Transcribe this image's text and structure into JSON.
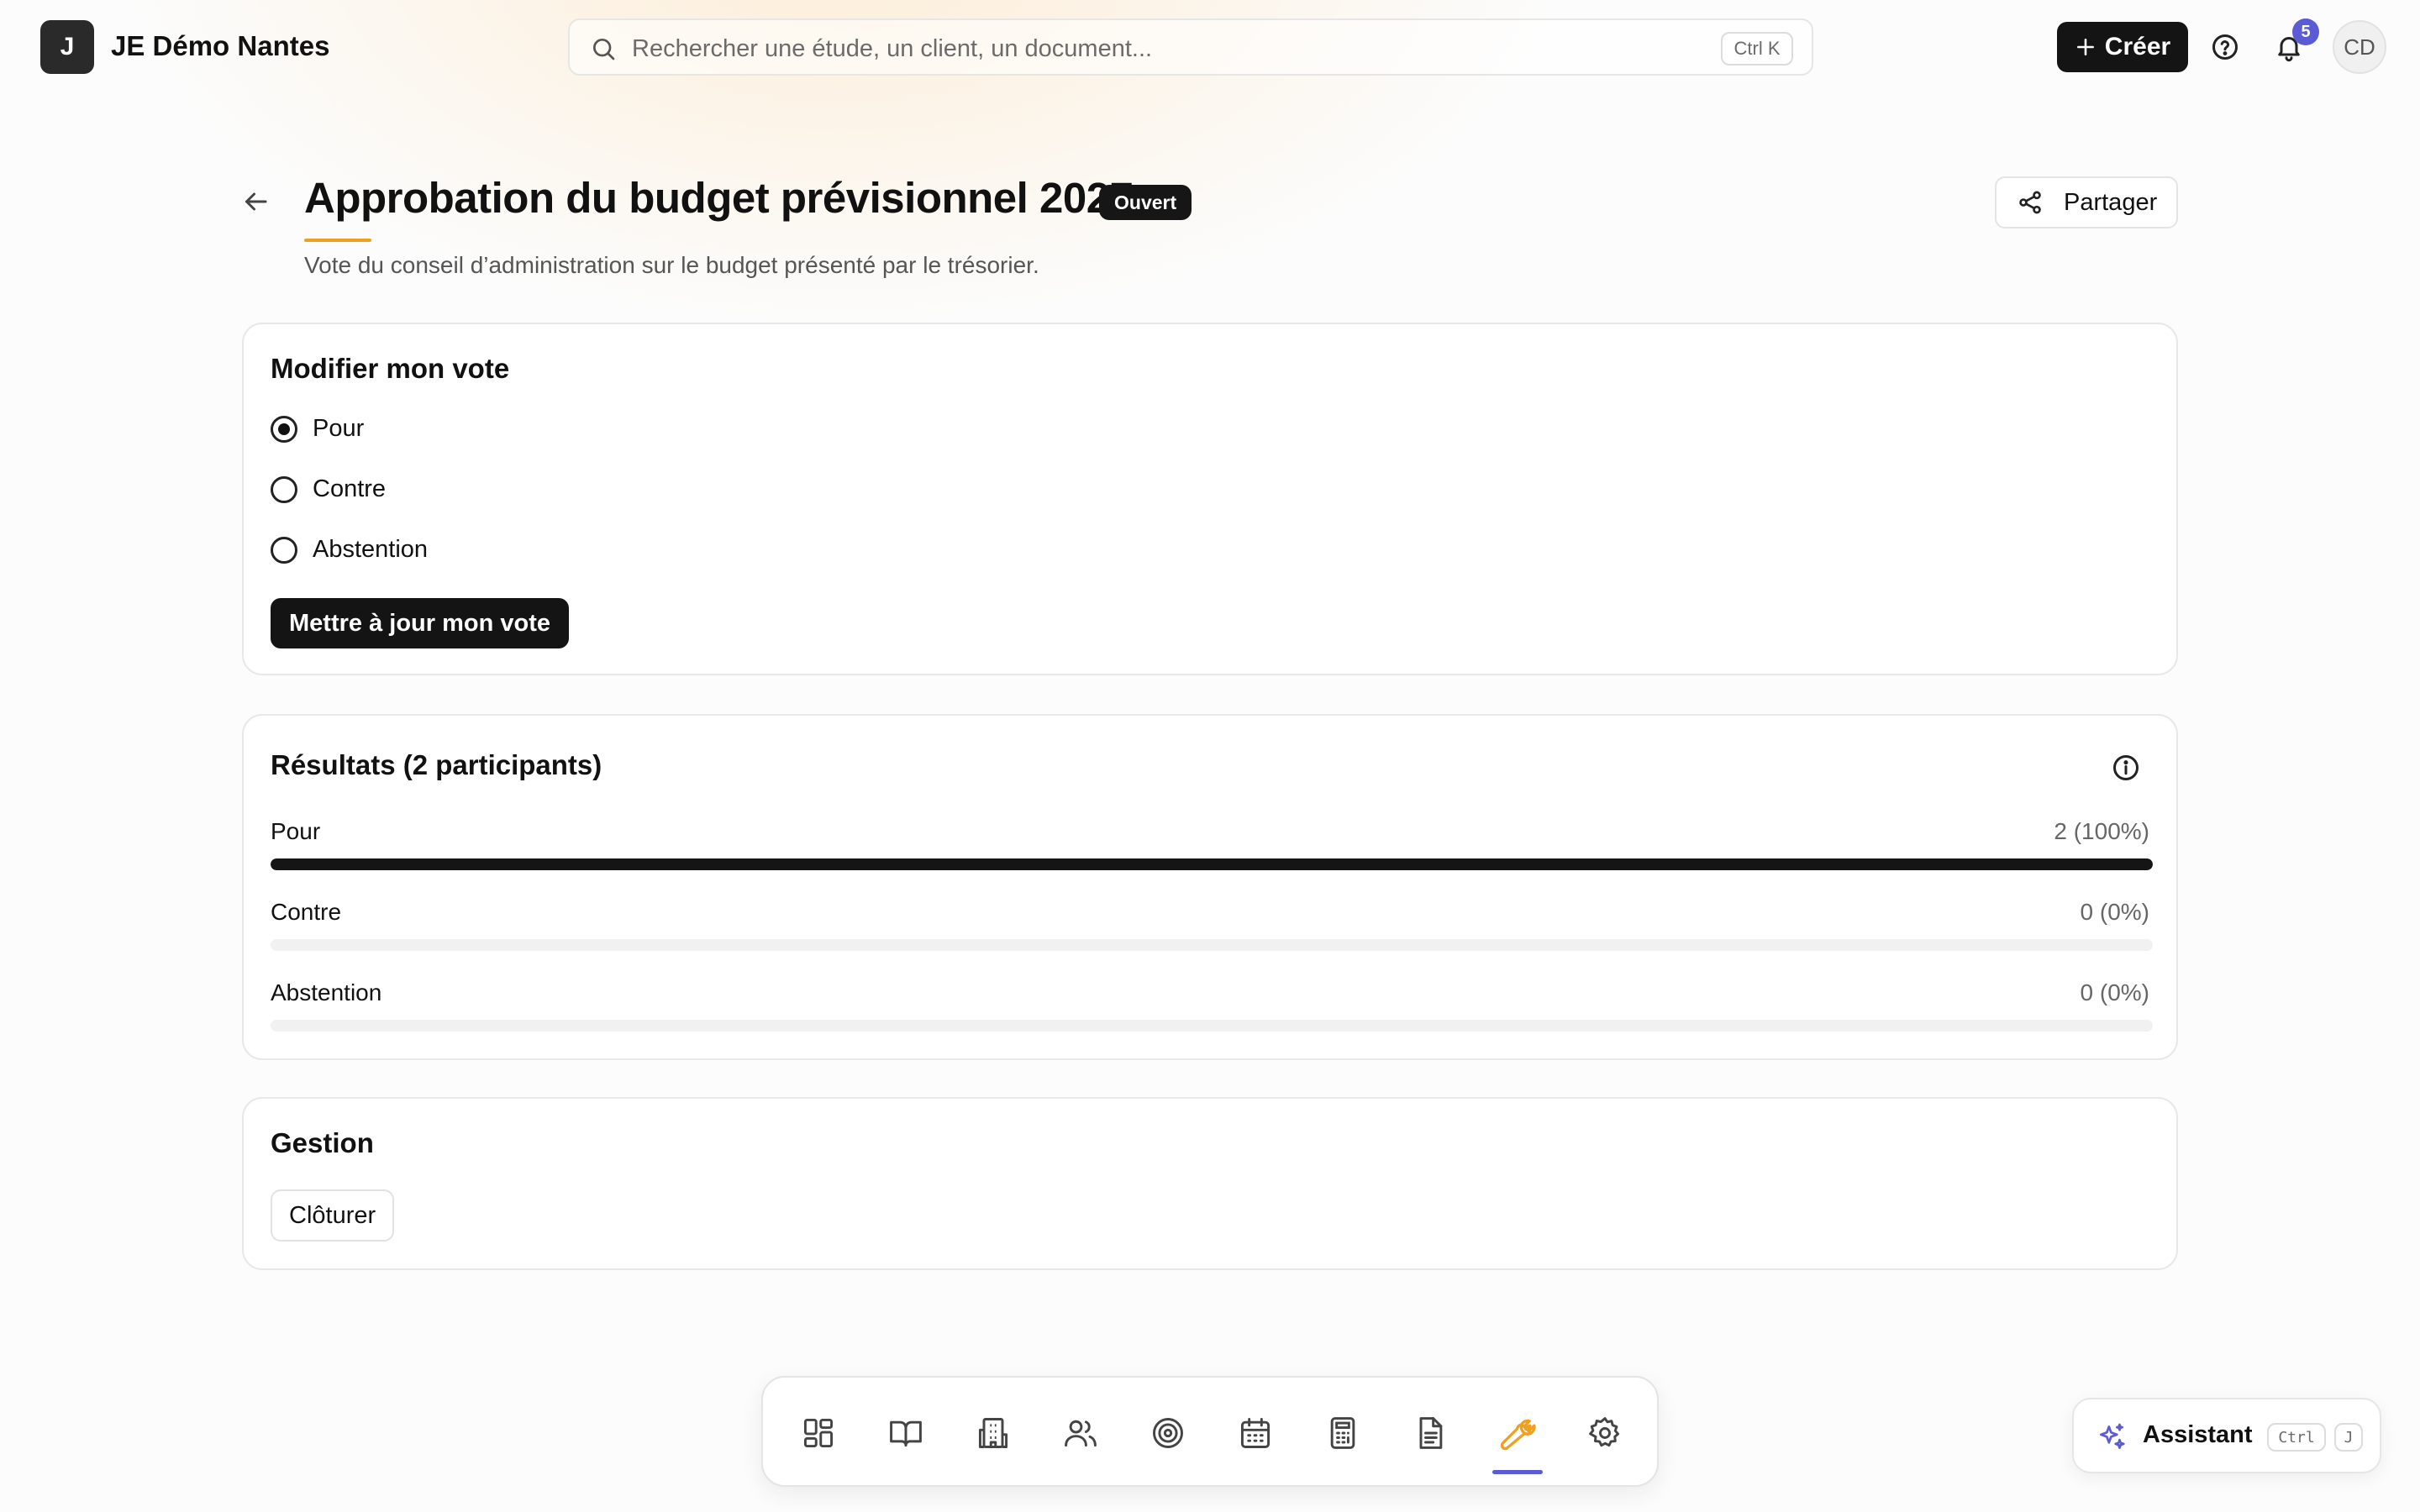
{
  "app": {
    "logo_letter": "J",
    "org_name": "JE Démo Nantes"
  },
  "search": {
    "placeholder": "Rechercher une étude, un client, un document...",
    "shortcut": "Ctrl K"
  },
  "header_actions": {
    "create_label": "Créer",
    "notification_count": "5",
    "user_initials": "CD"
  },
  "page": {
    "title": "Approbation du budget prévisionnel 2027",
    "status": "Ouvert",
    "subtitle": "Vote du conseil d’administration sur le budget présenté par le trésorier.",
    "share_label": "Partager"
  },
  "vote_card": {
    "title": "Modifier mon vote",
    "options": [
      {
        "label": "Pour",
        "checked": true
      },
      {
        "label": "Contre",
        "checked": false
      },
      {
        "label": "Abstention",
        "checked": false
      }
    ],
    "submit_label": "Mettre à jour mon vote"
  },
  "results_card": {
    "title": "Résultats (2 participants)",
    "rows": [
      {
        "label": "Pour",
        "value": "2 (100%)",
        "fraction": 1.0
      },
      {
        "label": "Contre",
        "value": "0 (0%)",
        "fraction": 0.0
      },
      {
        "label": "Abstention",
        "value": "0 (0%)",
        "fraction": 0.0
      }
    ]
  },
  "manage_card": {
    "title": "Gestion",
    "close_label": "Clôturer"
  },
  "dock": {
    "items": [
      {
        "icon": "dashboard-icon"
      },
      {
        "icon": "book-icon"
      },
      {
        "icon": "building-icon"
      },
      {
        "icon": "users-icon"
      },
      {
        "icon": "target-icon"
      },
      {
        "icon": "calendar-icon"
      },
      {
        "icon": "calculator-icon"
      },
      {
        "icon": "document-icon"
      },
      {
        "icon": "wrench-icon",
        "active": true
      },
      {
        "icon": "settings-icon"
      }
    ],
    "active_color": "#f0a020",
    "indicator_color": "#5b5bd6"
  },
  "assistant": {
    "label": "Assistant",
    "shortcut_key1": "Ctrl",
    "shortcut_key2": "J"
  }
}
